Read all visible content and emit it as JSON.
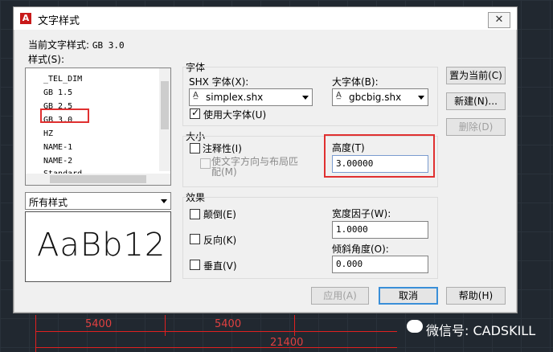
{
  "dialog": {
    "title": "文字样式",
    "close_label": "✕"
  },
  "current_style": {
    "label": "当前文字样式:",
    "value": "GB 3.0"
  },
  "styles": {
    "label": "样式(S):",
    "items": [
      "_TEL_DIM",
      "GB 1.5",
      "GB 2.5",
      "GB 3.0",
      "HZ",
      "NAME-1",
      "NAME-2",
      "Standard"
    ],
    "selected": "GB 3.0",
    "filter": "所有样式"
  },
  "preview": {
    "text": "AaBb12"
  },
  "font": {
    "group_label": "字体",
    "shx_label": "SHX 字体(X):",
    "shx_value": "simplex.shx",
    "big_label": "大字体(B):",
    "big_value": "gbcbig.shx",
    "use_big_label": "使用大字体(U)",
    "use_big_checked": true
  },
  "size": {
    "group_label": "大小",
    "annotative_label": "注释性(I)",
    "match_orientation_label": "使文字方向与布局匹配(M)",
    "height_label": "高度(T)",
    "height_value": "3.00000"
  },
  "effects": {
    "group_label": "效果",
    "upside_down_label": "颠倒(E)",
    "backwards_label": "反向(K)",
    "vertical_label": "垂直(V)",
    "width_factor_label": "宽度因子(W):",
    "width_factor_value": "1.0000",
    "oblique_label": "倾斜角度(O):",
    "oblique_value": "0.000"
  },
  "buttons": {
    "set_current": "置为当前(C)",
    "new": "新建(N)...",
    "delete": "删除(D)",
    "apply": "应用(A)",
    "cancel": "取消",
    "help": "帮助(H)"
  },
  "background": {
    "dim1": "5400",
    "dim2": "5400",
    "dim_total": "21400",
    "watermark": "微信号: CADSKILL"
  }
}
